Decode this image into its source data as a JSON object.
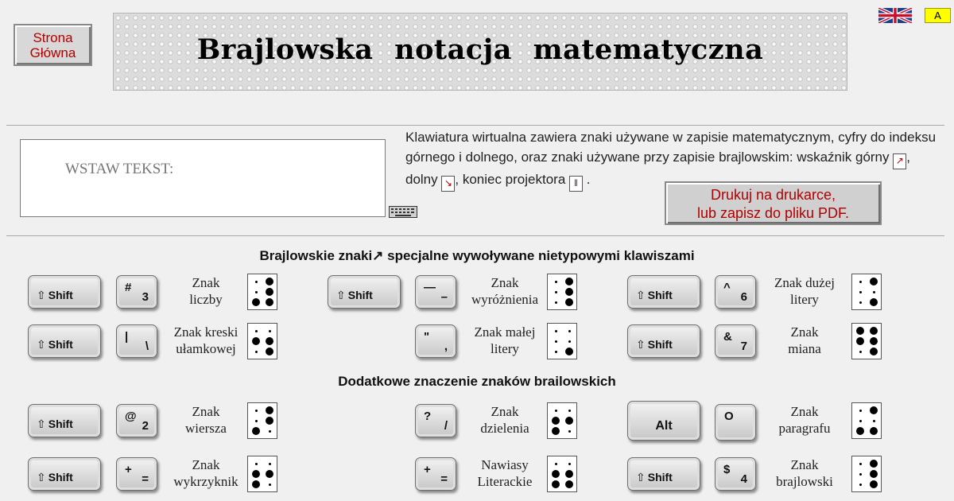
{
  "header": {
    "home_button": {
      "line1": "Strona",
      "line2": "Główna"
    },
    "banner_title": "Brajlowska notacja matematyczna",
    "contrast_button": "A"
  },
  "input": {
    "placeholder": "WSTAW TEKST:"
  },
  "description": {
    "part1": "Klawiatura wirtualna zawiera znaki używane w zapisie matematycznym, cyfry do indeksu górnego i dolnego, oraz znaki używane przy zapisie brajlowskim: wskaźnik górny",
    "sym_upper": "↗",
    "part2": ",",
    "part3": "dolny",
    "sym_lower": "↘",
    "part4": ", koniec projektora",
    "sym_end": "‖",
    "part5": "."
  },
  "print_button": {
    "line1": "Drukuj na drukarce,",
    "line2": "lub zapisz do pliku PDF."
  },
  "section1": {
    "title": "Brajlowskie znaki↗ specjalne wywoływane nietypowymi klawiszami"
  },
  "section2": {
    "title": "Dodatkowe znaczenie znaków brailowskich"
  },
  "keys": {
    "shift": "Shift",
    "alt": "Alt"
  },
  "groups": [
    {
      "id": "liczby",
      "mod": "Shift",
      "key_top": "#",
      "key_bottom": "3",
      "label": [
        "Znak",
        "liczby"
      ],
      "dots": [
        3,
        4,
        5,
        6
      ]
    },
    {
      "id": "wyroznienia",
      "mod": "Shift",
      "key_top": "—",
      "key_bottom": "–",
      "label": [
        "Znak",
        "wyróżnienia"
      ],
      "dots": [
        4,
        5,
        6
      ]
    },
    {
      "id": "duzej",
      "mod": "Shift",
      "key_top": "^",
      "key_bottom": "6",
      "label": [
        "Znak dużej",
        "litery"
      ],
      "dots": [
        4,
        6
      ]
    },
    {
      "id": "kreski",
      "mod": "Shift",
      "key_top": "|",
      "key_bottom": "\\",
      "label": [
        "Znak kreski",
        "ułamkowej"
      ],
      "dots": [
        2,
        5,
        6
      ]
    },
    {
      "id": "malej",
      "mod": "",
      "key_top": "\"",
      "key_bottom": ",",
      "label": [
        "Znak małej",
        "litery"
      ],
      "dots": [
        6
      ]
    },
    {
      "id": "miana",
      "mod": "Shift",
      "key_top": "&",
      "key_bottom": "7",
      "label": [
        "Znak",
        "miana"
      ],
      "dots": [
        1,
        2,
        4,
        5,
        6
      ]
    },
    {
      "id": "wiersza",
      "mod": "Shift",
      "key_top": "@",
      "key_bottom": "2",
      "label": [
        "Znak",
        "wiersza"
      ],
      "dots": [
        3,
        4,
        5
      ]
    },
    {
      "id": "dzielenia",
      "mod": "",
      "key_top": "?",
      "key_bottom": "/",
      "label": [
        "Znak",
        "dzielenia"
      ],
      "dots": [
        2,
        3,
        5
      ]
    },
    {
      "id": "paragrafu",
      "mod": "Alt",
      "key_top": "O",
      "key_bottom": "",
      "label": [
        "Znak",
        "paragrafu"
      ],
      "dots": [
        3,
        4,
        6
      ]
    },
    {
      "id": "wykrzyknik",
      "mod": "Shift",
      "key_top": "+",
      "key_bottom": "=",
      "label": [
        "Znak",
        "wykrzyknik"
      ],
      "dots": [
        2,
        3,
        5
      ]
    },
    {
      "id": "literackie",
      "mod": "",
      "key_top": "+",
      "key_bottom": "=",
      "label": [
        "Nawiasy",
        "Literackie"
      ],
      "dots": [
        2,
        3,
        5,
        6
      ]
    },
    {
      "id": "brajlowski",
      "mod": "Shift",
      "key_top": "$",
      "key_bottom": "4",
      "label": [
        "Znak",
        "brajlowski"
      ],
      "dots": [
        4,
        5,
        6
      ]
    }
  ]
}
